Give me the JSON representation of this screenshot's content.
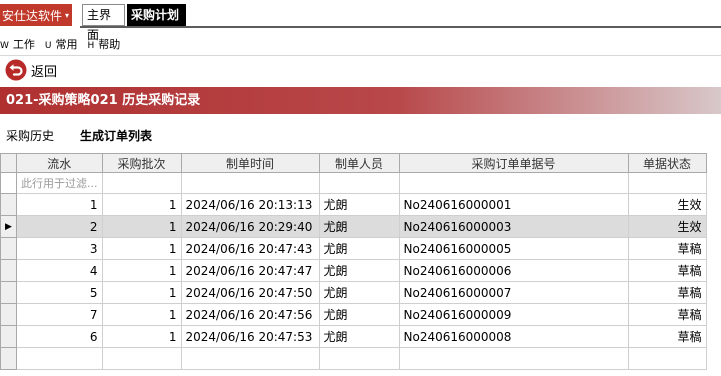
{
  "app": {
    "menu_label": "安仕达软件",
    "caret": "▾"
  },
  "tabs": [
    {
      "label": "主界面"
    },
    {
      "label": "采购计划"
    }
  ],
  "menubar": [
    {
      "key": "W",
      "label": "工作"
    },
    {
      "key": "U",
      "label": "常用"
    },
    {
      "key": "H",
      "label": "帮助"
    }
  ],
  "toolbar": {
    "back_label": "返回",
    "back_icon": "back-arrow-icon"
  },
  "band": {
    "title": "021-采购策略021 历史采购记录"
  },
  "subtabs": [
    {
      "label": "采购历史"
    },
    {
      "label": "生成订单列表"
    }
  ],
  "grid": {
    "columns": [
      "流水",
      "采购批次",
      "制单时间",
      "制单人员",
      "采购订单单据号",
      "单据状态"
    ],
    "filter_placeholder": "此行用于过滤...",
    "rows": [
      {
        "seq": "1",
        "batch": "1",
        "time": "2024/06/16 20:13:13",
        "person": "尤朗",
        "order_no": "No240616000001",
        "status": "生效"
      },
      {
        "seq": "2",
        "batch": "1",
        "time": "2024/06/16 20:29:40",
        "person": "尤朗",
        "order_no": "No240616000003",
        "status": "生效"
      },
      {
        "seq": "3",
        "batch": "1",
        "time": "2024/06/16 20:47:43",
        "person": "尤朗",
        "order_no": "No240616000005",
        "status": "草稿"
      },
      {
        "seq": "4",
        "batch": "1",
        "time": "2024/06/16 20:47:47",
        "person": "尤朗",
        "order_no": "No240616000006",
        "status": "草稿"
      },
      {
        "seq": "5",
        "batch": "1",
        "time": "2024/06/16 20:47:50",
        "person": "尤朗",
        "order_no": "No240616000007",
        "status": "草稿"
      },
      {
        "seq": "7",
        "batch": "1",
        "time": "2024/06/16 20:47:56",
        "person": "尤朗",
        "order_no": "No240616000009",
        "status": "草稿"
      },
      {
        "seq": "6",
        "batch": "1",
        "time": "2024/06/16 20:47:53",
        "person": "尤朗",
        "order_no": "No240616000008",
        "status": "草稿"
      }
    ],
    "selected_row": 2
  },
  "colors": {
    "accent_red": "#c0392b",
    "band_red": "#b03030"
  }
}
